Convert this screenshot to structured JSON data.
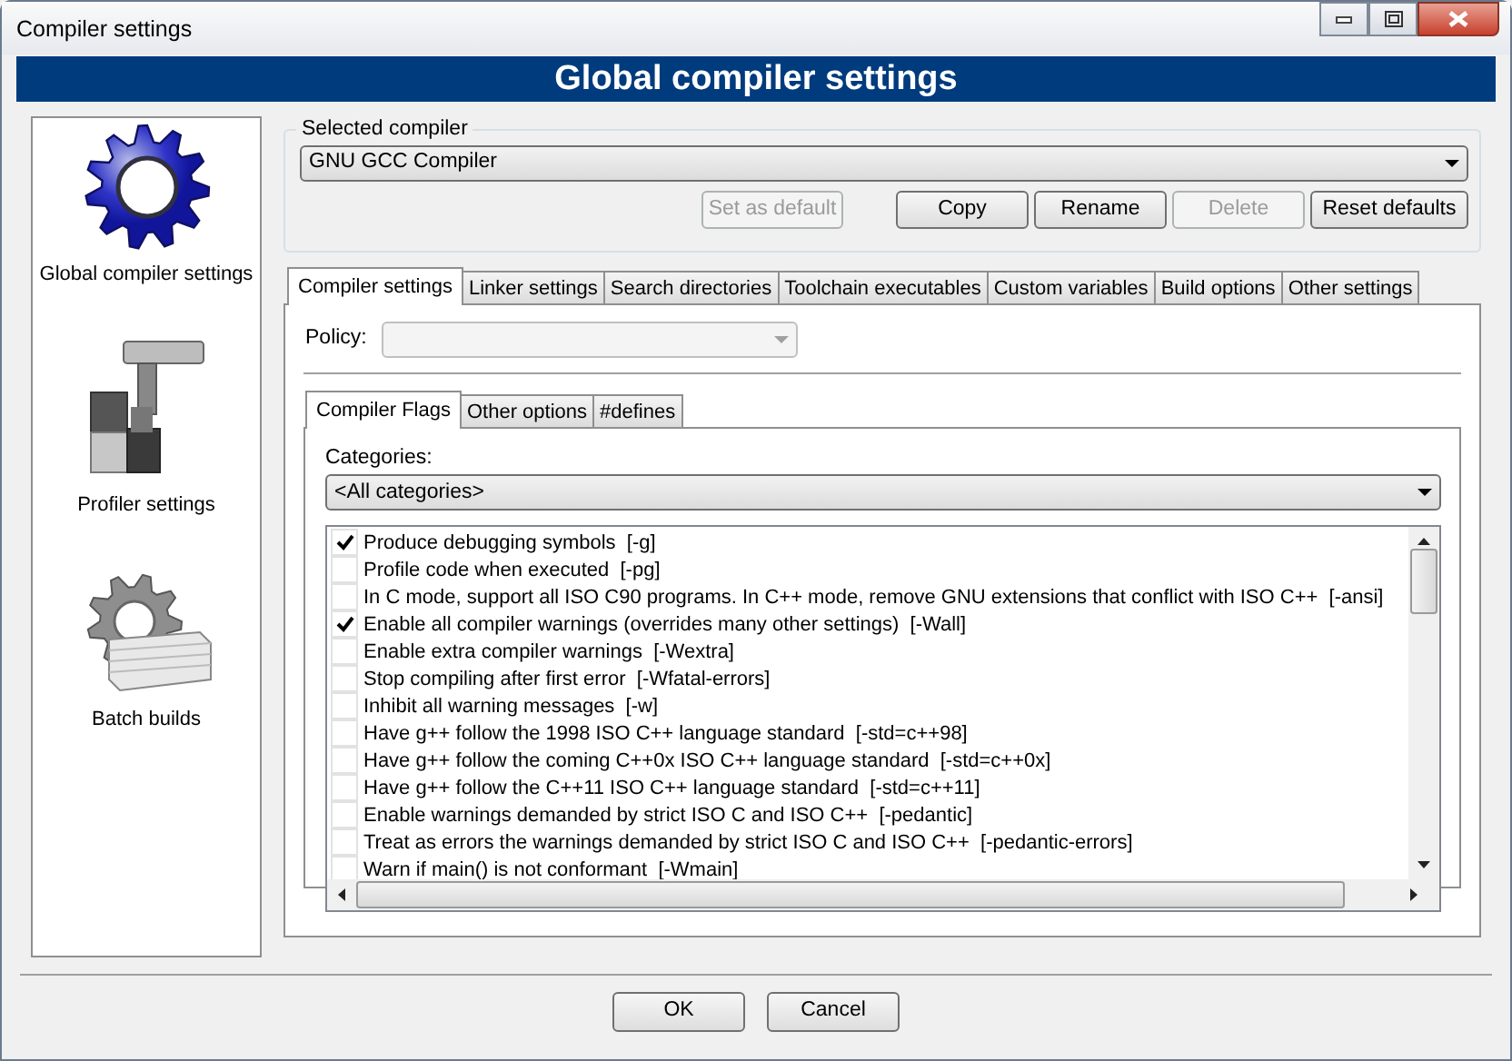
{
  "window": {
    "title": "Compiler settings"
  },
  "header": "Global compiler settings",
  "sidebar": {
    "items": [
      {
        "label": "Global compiler settings",
        "kind": "gear"
      },
      {
        "label": "Profiler settings",
        "kind": "profiler"
      },
      {
        "label": "Batch builds",
        "kind": "batch"
      }
    ]
  },
  "selected_compiler": {
    "label": "Selected compiler",
    "value": "GNU GCC Compiler",
    "buttons": [
      {
        "label": "Set as default",
        "disabled": true
      },
      {
        "label": "Copy",
        "disabled": false
      },
      {
        "label": "Rename",
        "disabled": false
      },
      {
        "label": "Delete",
        "disabled": true
      },
      {
        "label": "Reset defaults",
        "disabled": false
      }
    ]
  },
  "tabs": [
    {
      "label": "Compiler settings",
      "selected": true
    },
    {
      "label": "Linker settings",
      "selected": false
    },
    {
      "label": "Search directories",
      "selected": false
    },
    {
      "label": "Toolchain executables",
      "selected": false
    },
    {
      "label": "Custom variables",
      "selected": false
    },
    {
      "label": "Build options",
      "selected": false
    },
    {
      "label": "Other settings",
      "selected": false
    }
  ],
  "policy": {
    "label": "Policy:",
    "disabled": true
  },
  "sub_tabs": [
    {
      "label": "Compiler Flags",
      "selected": true
    },
    {
      "label": "Other options",
      "selected": false
    },
    {
      "label": "#defines",
      "selected": false
    }
  ],
  "categories": {
    "label": "Categories:",
    "value": "<All categories>"
  },
  "flags": [
    {
      "label": "Produce debugging symbols  [-g]",
      "checked": true
    },
    {
      "label": "Profile code when executed  [-pg]",
      "checked": false
    },
    {
      "label": "In C mode, support all ISO C90 programs. In C++ mode, remove GNU extensions that conflict with ISO C++  [-ansi]",
      "checked": false
    },
    {
      "label": "Enable all compiler warnings (overrides many other settings)  [-Wall]",
      "checked": true
    },
    {
      "label": "Enable extra compiler warnings  [-Wextra]",
      "checked": false
    },
    {
      "label": "Stop compiling after first error  [-Wfatal-errors]",
      "checked": false
    },
    {
      "label": "Inhibit all warning messages  [-w]",
      "checked": false
    },
    {
      "label": "Have g++ follow the 1998 ISO C++ language standard  [-std=c++98]",
      "checked": false
    },
    {
      "label": "Have g++ follow the coming C++0x ISO C++ language standard  [-std=c++0x]",
      "checked": false
    },
    {
      "label": "Have g++ follow the C++11 ISO C++ language standard  [-std=c++11]",
      "checked": false
    },
    {
      "label": "Enable warnings demanded by strict ISO C and ISO C++  [-pedantic]",
      "checked": false
    },
    {
      "label": "Treat as errors the warnings demanded by strict ISO C and ISO C++  [-pedantic-errors]",
      "checked": false
    },
    {
      "label": "Warn if main() is not conformant  [-Wmain]",
      "checked": false
    }
  ],
  "buttons": [
    "OK",
    "Cancel"
  ]
}
